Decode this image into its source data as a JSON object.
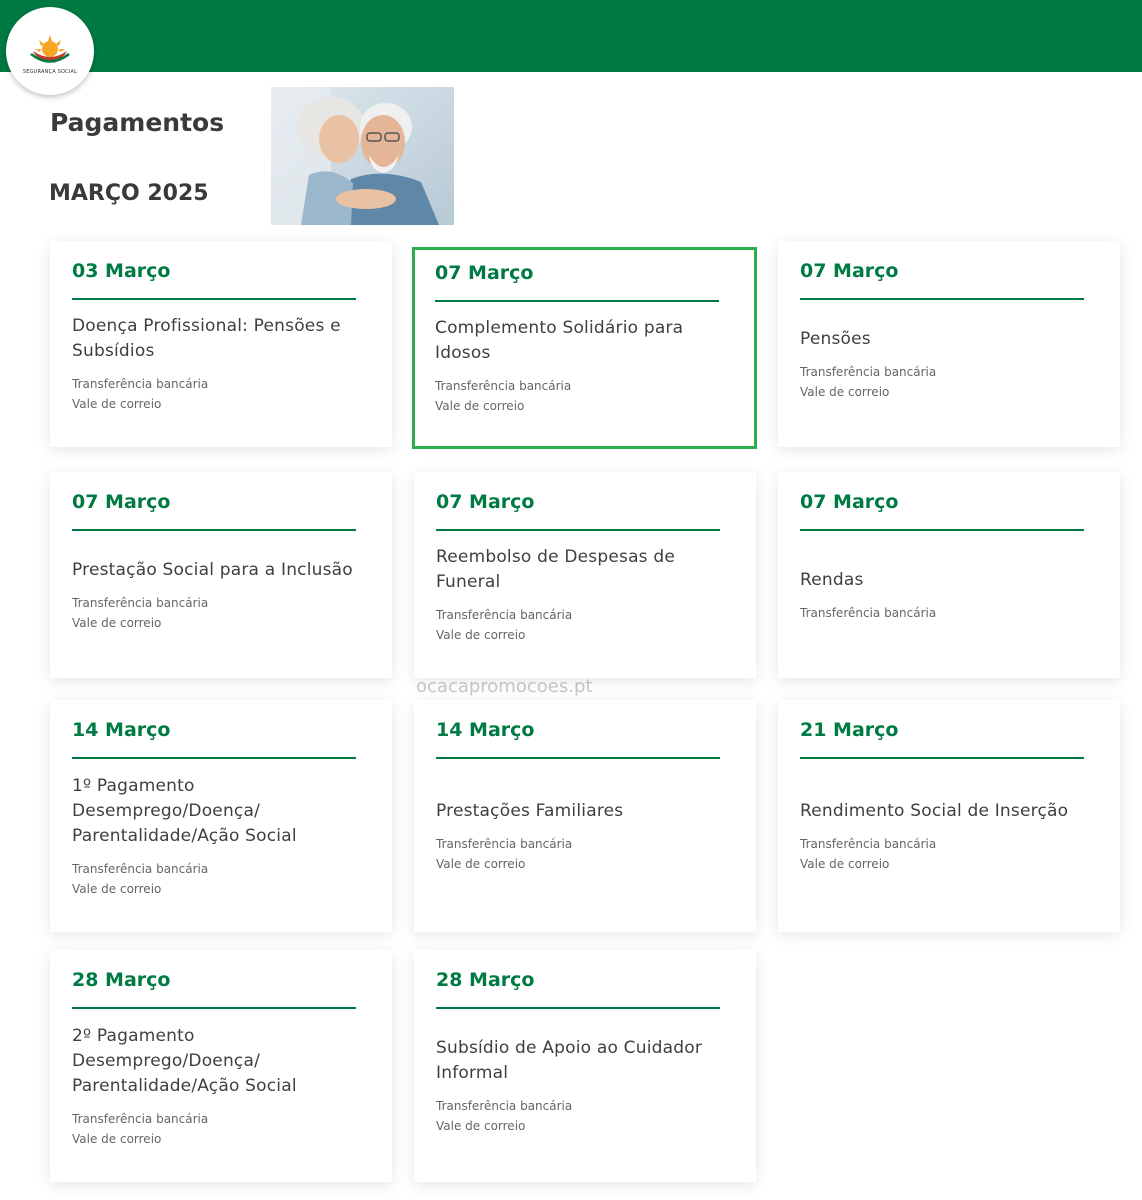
{
  "header": {
    "logo_text": "Segurança Social",
    "page_title": "Pagamentos",
    "month_title": "MARÇO 2025",
    "brand_color": "#007a43",
    "highlight_color": "#2eae4a"
  },
  "watermark": "ocacapromocoes.pt",
  "methods": {
    "transfer": "Transferência bancária",
    "postal": "Vale de correio"
  },
  "cards": [
    {
      "date": "03 Março",
      "title": "Doença Profissional: Pensões e Subsídios",
      "methods": [
        "Transferência bancária",
        "Vale de correio"
      ]
    },
    {
      "date": "07 Março",
      "title": "Complemento Solidário para Idosos",
      "methods": [
        "Transferência bancária",
        "Vale de correio"
      ],
      "highlighted": true
    },
    {
      "date": "07 Março",
      "title": "Pensões",
      "methods": [
        "Transferência bancária",
        "Vale de correio"
      ]
    },
    {
      "date": "07 Março",
      "title": "Prestação Social para a Inclusão",
      "methods": [
        "Transferência bancária",
        "Vale de correio"
      ]
    },
    {
      "date": "07 Março",
      "title": "Reembolso de Despesas de Funeral",
      "methods": [
        "Transferência bancária",
        "Vale de correio"
      ]
    },
    {
      "date": "07 Março",
      "title": "Rendas",
      "methods": [
        "Transferência bancária"
      ]
    },
    {
      "date": "14 Março",
      "title": "1º Pagamento Desemprego/Doença/ Parentalidade/Ação Social",
      "methods": [
        "Transferência bancária",
        "Vale de correio"
      ]
    },
    {
      "date": "14 Março",
      "title": "Prestações Familiares",
      "methods": [
        "Transferência bancária",
        "Vale de correio"
      ]
    },
    {
      "date": "21 Março",
      "title": "Rendimento Social de Inserção",
      "methods": [
        "Transferência bancária",
        "Vale de correio"
      ]
    },
    {
      "date": "28 Março",
      "title": "2º Pagamento Desemprego/Doença/ Parentalidade/Ação Social",
      "methods": [
        "Transferência bancária",
        "Vale de correio"
      ]
    },
    {
      "date": "28 Março",
      "title": "Subsídio de Apoio ao Cuidador Informal",
      "methods": [
        "Transferência bancária",
        "Vale de correio"
      ]
    }
  ]
}
